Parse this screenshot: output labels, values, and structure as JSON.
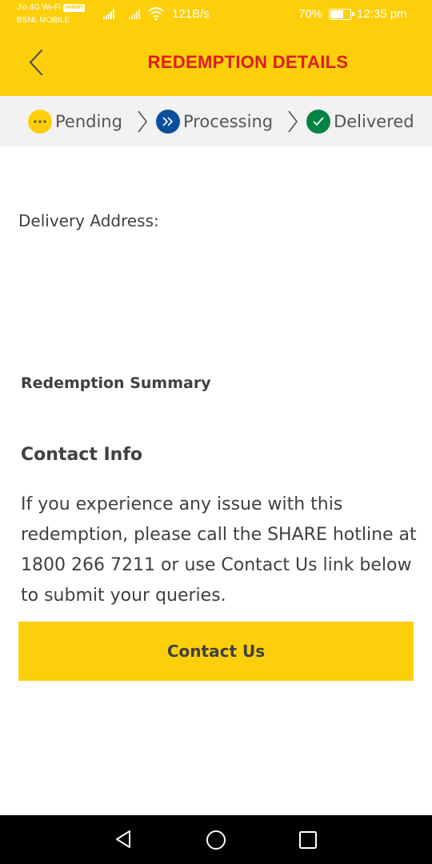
{
  "status_bar": {
    "carrier_primary": "Jio 4G Wi-Fi",
    "volte_badge": "VoWiFi",
    "carrier_secondary": "BSNL MOBILE",
    "network_speed": "121B/s",
    "battery_percent": "70%",
    "battery_level": 0.7,
    "time": "12:35 pm"
  },
  "header": {
    "title": "REDEMPTION DETAILS",
    "back_icon": "chevron-left-icon"
  },
  "progress": {
    "steps": [
      {
        "label": "Pending",
        "icon": "ellipsis-icon",
        "color": "#fccf0a"
      },
      {
        "label": "Processing",
        "icon": "double-chevron-right-icon",
        "color": "#0a4f9b"
      },
      {
        "label": "Delivered",
        "icon": "check-icon",
        "color": "#008443"
      }
    ]
  },
  "content": {
    "delivery_label": "Delivery Address:",
    "summary_heading": "Redemption Summary",
    "contact_heading": "Contact Info",
    "contact_text": "If you experience any issue with this redemption, please call the SHARE hotline at 1800 266 7211 or use Contact Us link below to submit your queries.",
    "contact_button": "Contact Us"
  },
  "colors": {
    "brand_yellow": "#fccf0a",
    "brand_red": "#dd1d21"
  }
}
